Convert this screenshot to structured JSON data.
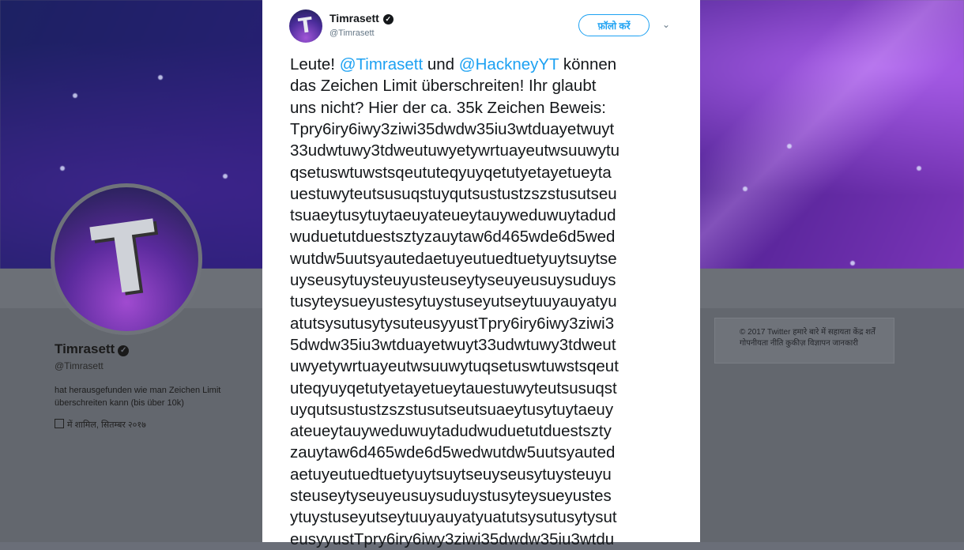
{
  "profile": {
    "name": "Timrasett",
    "handle": "@Timrasett",
    "bio": "hat herausgefunden wie man Zeichen Limit überschreiten kann (bis über 10k)",
    "joined": "में शामिल, सितम्बर २०१७",
    "avatar_letter": "T"
  },
  "footer": {
    "text": "© 2017 Twitter  हमारे बारे में  सहायता केंद्र  शर्तें  गोपनीयता नीति  कुकीज़  विज्ञापन जानकारी"
  },
  "tweet": {
    "author_name": "Timrasett",
    "author_handle": "@Timrasett",
    "avatar_letter": "T",
    "follow_label": "फ़ॉलो करें",
    "chevron": "⌄",
    "intro_lines": [
      {
        "a": "Leute! ",
        "m1": "@Timrasett",
        "b": " und ",
        "m2": "@HackneyYT",
        "c": " können"
      },
      {
        "a": "das Zeichen Limit überschreiten! Ihr glaubt"
      },
      {
        "a": "uns nicht? Hier der ca. 35k Zeichen Beweis:"
      }
    ],
    "body_lines": [
      "Tpry6iry6iwy3ziwi35dwdw35iu3wtduayetwuyt",
      "33udwtuwy3tdweutuwyetywrtuayeutwsuuwytu",
      "qsetuswtuwstsqeututeqyuyqetutyetayetueyta",
      "uestuwyteutsusuqstuyqutsustustzszstusutseu",
      "tsuaeytusytuytaeuyateueytauyweduwuytadud",
      "wuduetutduestsztyzauytaw6d465wde6d5wed",
      "wutdw5uutsyautedaetuyeutuedtuetyuytsuytse",
      "uyseusytuysteuyusteuseytyseuyeusuysuduys",
      "tusyteysueyustesytuystuseyutseytuuyauyatyu",
      "atutsysutusytysuteusyyustTpry6iry6iwy3ziwi3",
      "5dwdw35iu3wtduayetwuyt33udwtuwy3tdweut",
      "uwyetywrtuayeutwsuuwytuqsetuswtuwstsqeut",
      "uteqyuyqetutyetayetueytauestuwyteutsusuqst",
      "uyqutsustustzszstusutseutsuaeytusytuytaeuy",
      "ateueytauyweduwuytadudwuduetutduestszty",
      "zauytaw6d465wde6d5wedwutdw5uutsyauted",
      "aetuyeutuedtuetyuytsuytseuyseusytuysteuyu",
      "steuseytyseuyeusuysuduystusyteysueyustes",
      "ytuystuseyutseytuuyauyatyuatutsysutusytysut",
      "eusyyustTpry6iry6iwy3ziwi35dwdw35iu3wtdu"
    ]
  }
}
